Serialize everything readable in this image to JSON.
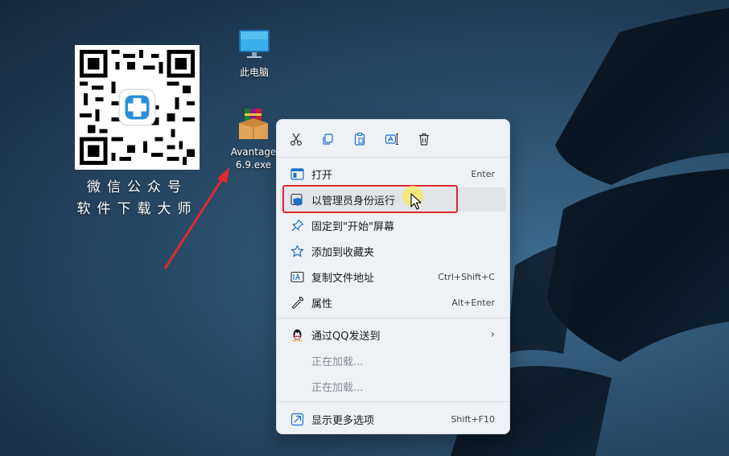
{
  "qr": {
    "caption_line1": "微信公众号",
    "caption_line2": "软件下载大师"
  },
  "desktop": {
    "this_pc": {
      "label": "此电脑",
      "icon": "monitor-icon"
    },
    "installer": {
      "label_line1": "Avantage",
      "label_line2": "6.9.exe",
      "icon": "winrar-archive-icon"
    }
  },
  "context_menu": {
    "toolbar": [
      {
        "name": "cut",
        "icon": "scissors-icon"
      },
      {
        "name": "copy",
        "icon": "copy-icon"
      },
      {
        "name": "paste",
        "icon": "clipboard-icon"
      },
      {
        "name": "rename",
        "icon": "rename-icon"
      },
      {
        "name": "delete",
        "icon": "trash-icon"
      }
    ],
    "items": [
      {
        "label": "打开",
        "shortcut": "Enter",
        "icon": "app-window-icon"
      },
      {
        "label": "以管理员身份运行",
        "shortcut": "",
        "icon": "shield-icon"
      },
      {
        "label": "固定到\"开始\"屏幕",
        "shortcut": "",
        "icon": "pin-icon"
      },
      {
        "label": "添加到收藏夹",
        "shortcut": "",
        "icon": "star-icon"
      },
      {
        "label": "复制文件地址",
        "shortcut": "Ctrl+Shift+C",
        "icon": "path-icon"
      },
      {
        "label": "属性",
        "shortcut": "Alt+Enter",
        "icon": "wrench-icon"
      },
      {
        "label": "通过QQ发送到",
        "shortcut": "",
        "icon": "qq-icon"
      },
      {
        "label": "正在加载...",
        "shortcut": "",
        "icon": ""
      },
      {
        "label": "正在加载...",
        "shortcut": "",
        "icon": ""
      },
      {
        "label": "显示更多选项",
        "shortcut": "Shift+F10",
        "icon": "external-icon"
      }
    ]
  },
  "colors": {
    "accent": "#0067c0",
    "highlight": "#e0282d",
    "menu_bg": "#eef1f5"
  }
}
